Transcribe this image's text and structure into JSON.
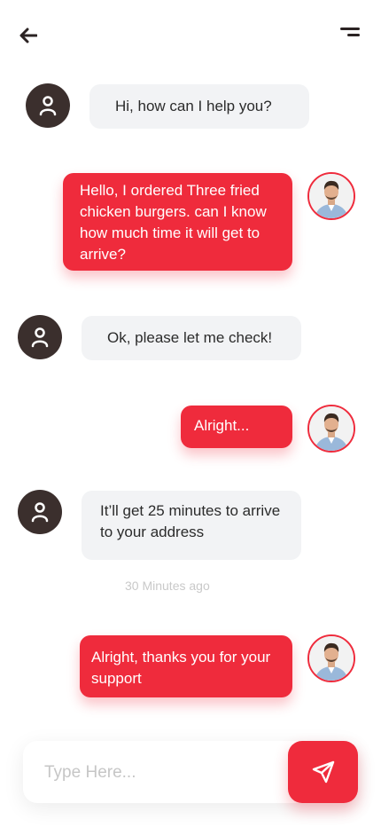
{
  "header": {
    "back_icon": "arrow-left-icon",
    "menu_icon": "menu-icon"
  },
  "messages": [
    {
      "sender": "support",
      "text": "Hi, how can I help you?"
    },
    {
      "sender": "user",
      "text": "Hello, I ordered Three fried chicken burgers. can I know how much time it will get to arrive?"
    },
    {
      "sender": "support",
      "text": "Ok, please let me check!"
    },
    {
      "sender": "user",
      "text": "Alright..."
    },
    {
      "sender": "support",
      "text": "It’ll get 25 minutes to arrive to your address"
    },
    {
      "sender": "user",
      "text": "Alright, thanks you for your support"
    }
  ],
  "timestamp": "30 Minutes ago",
  "composer": {
    "placeholder": "Type Here...",
    "value": "",
    "send_icon": "send-icon"
  },
  "colors": {
    "accent": "#ef2b3c",
    "support_bubble": "#f2f3f5",
    "support_avatar": "#3b2f2d"
  }
}
